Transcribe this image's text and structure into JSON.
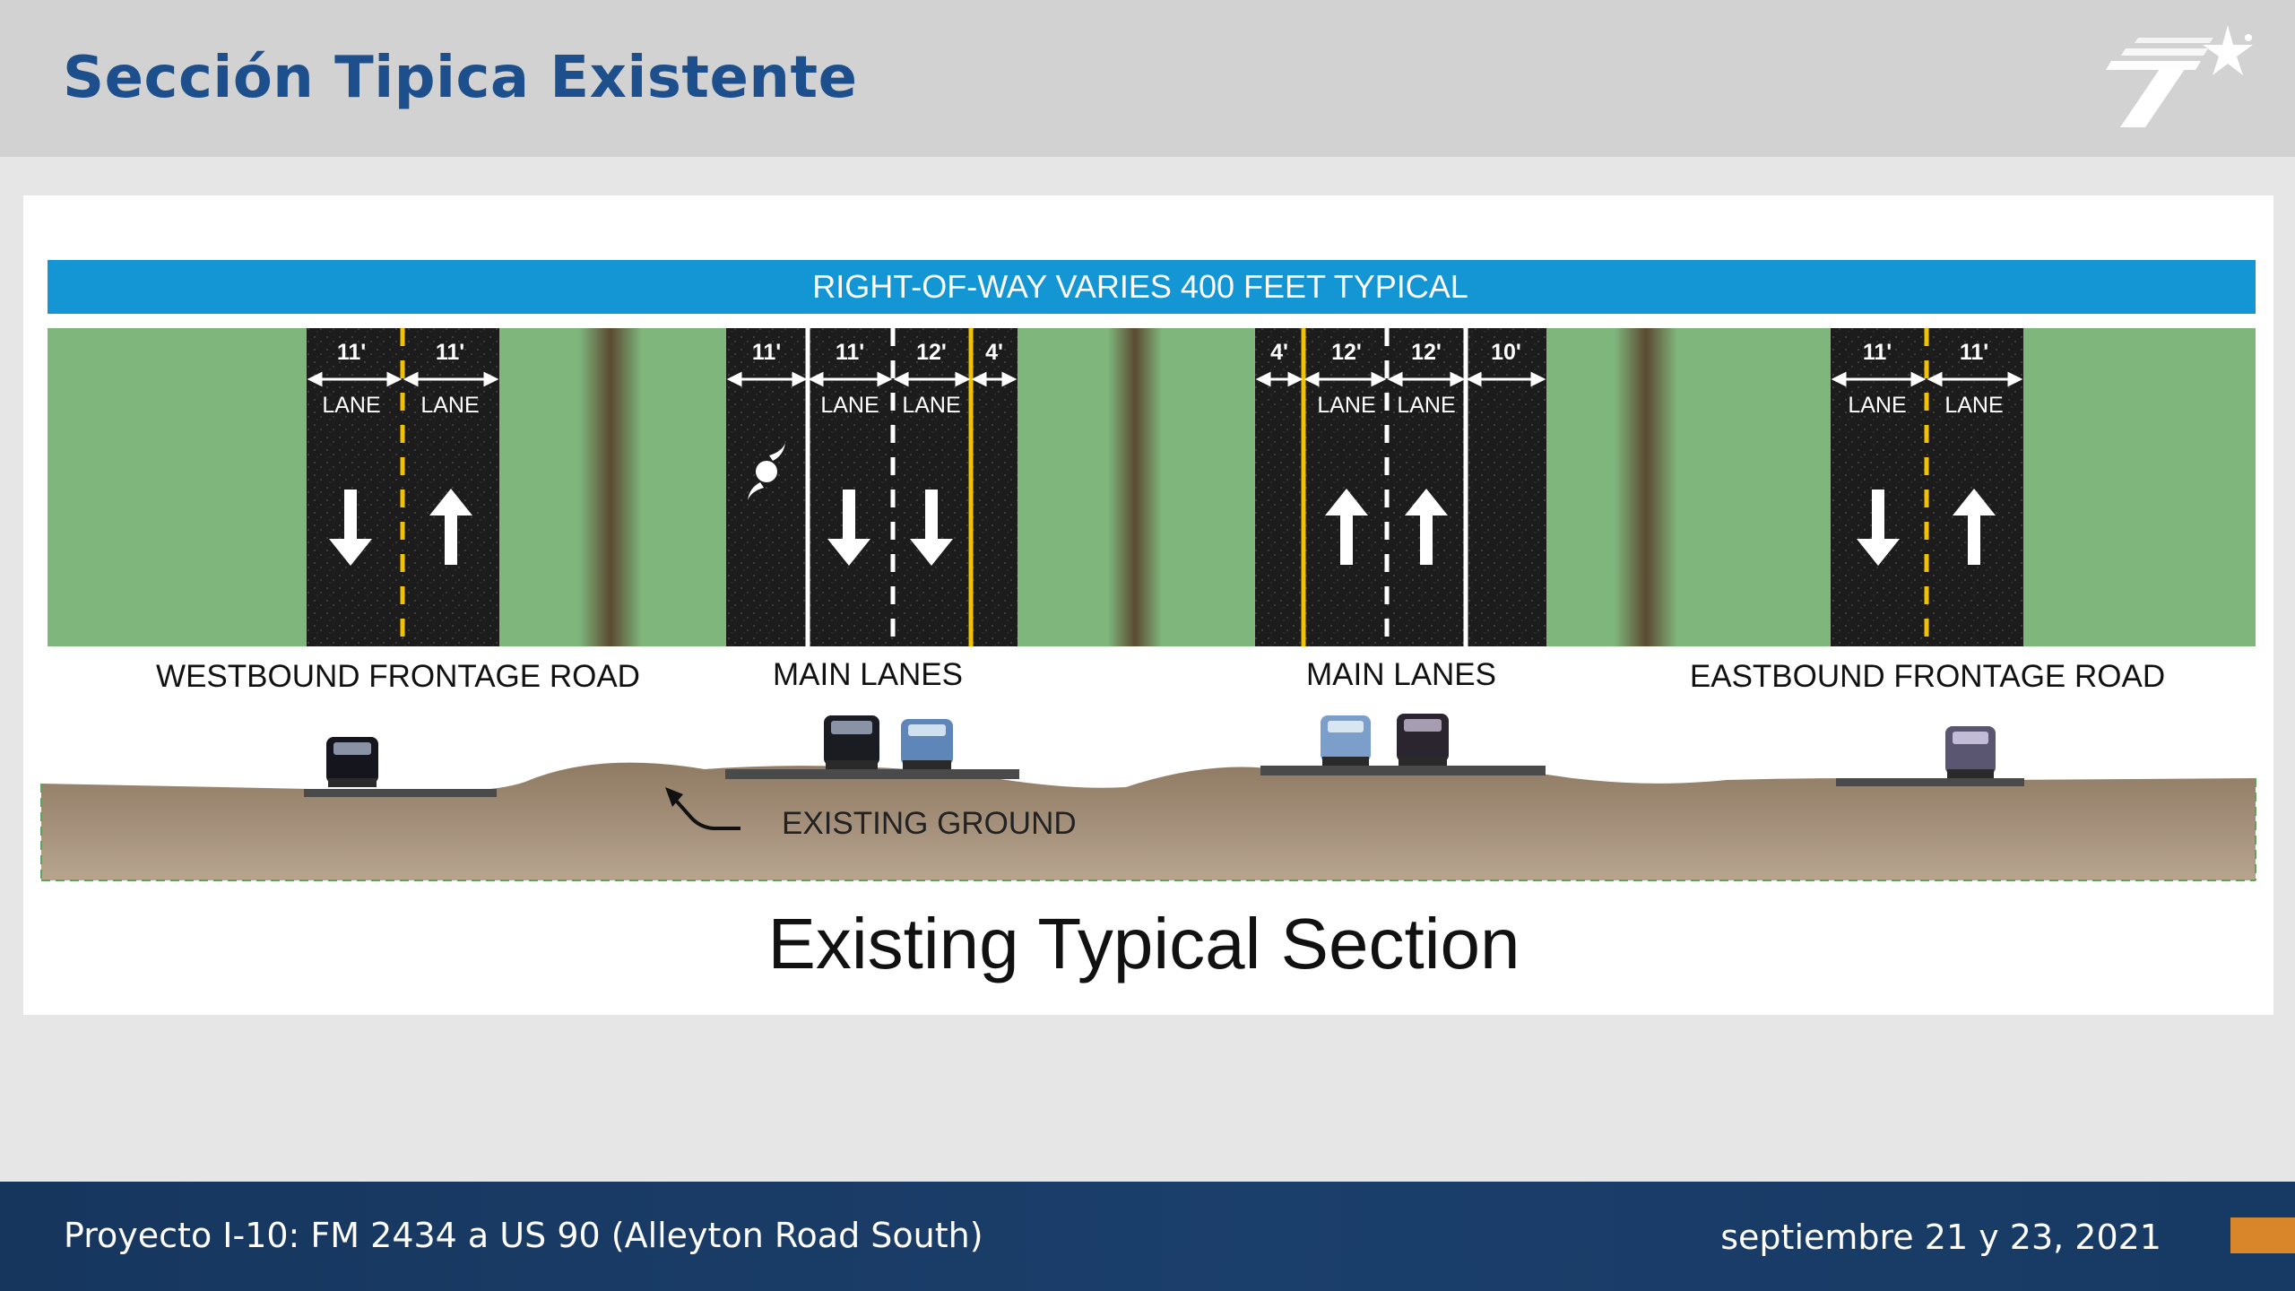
{
  "header": {
    "title": "Sección Tipica Existente",
    "logo_icon": "txdot-star-logo-icon"
  },
  "diagram": {
    "banner_text": "RIGHT-OF-WAY VARIES 400 FEET TYPICAL",
    "sections": [
      {
        "label": "WESTBOUND FRONTAGE ROAD",
        "dims": [
          "11'",
          "11'"
        ],
        "lanes": [
          "LANE",
          "LANE"
        ],
        "arrows": [
          "down",
          "up"
        ]
      },
      {
        "label": "MAIN LANES",
        "dims": [
          "11'",
          "11'",
          "12'",
          "4'"
        ],
        "lanes": [
          "LANE",
          "LANE"
        ],
        "arrows": [
          "down",
          "down"
        ],
        "symbol": "hurricane-evacuation-icon"
      },
      {
        "label": "MAIN LANES",
        "dims": [
          "4'",
          "12'",
          "12'",
          "10'"
        ],
        "lanes": [
          "LANE",
          "LANE"
        ],
        "arrows": [
          "up",
          "up"
        ]
      },
      {
        "label": "EASTBOUND FRONTAGE ROAD",
        "dims": [
          "11'",
          "11'"
        ],
        "lanes": [
          "LANE",
          "LANE"
        ],
        "arrows": [
          "down",
          "up"
        ]
      }
    ],
    "ground_label": "EXISTING GROUND",
    "caption": "Existing Typical Section"
  },
  "footer": {
    "project": "Proyecto I-10: FM 2434 a US 90 (Alleyton Road South)",
    "date": "septiembre 21 y 23, 2021"
  },
  "colors": {
    "title_blue": "#1d4f8c",
    "banner_blue": "#1396d3",
    "grass_green": "#7fb67c",
    "pavement": "#1c1c1c",
    "ground_brown": "#a48f78",
    "footer_navy": "#16365e",
    "footer_accent": "#d9852a"
  }
}
